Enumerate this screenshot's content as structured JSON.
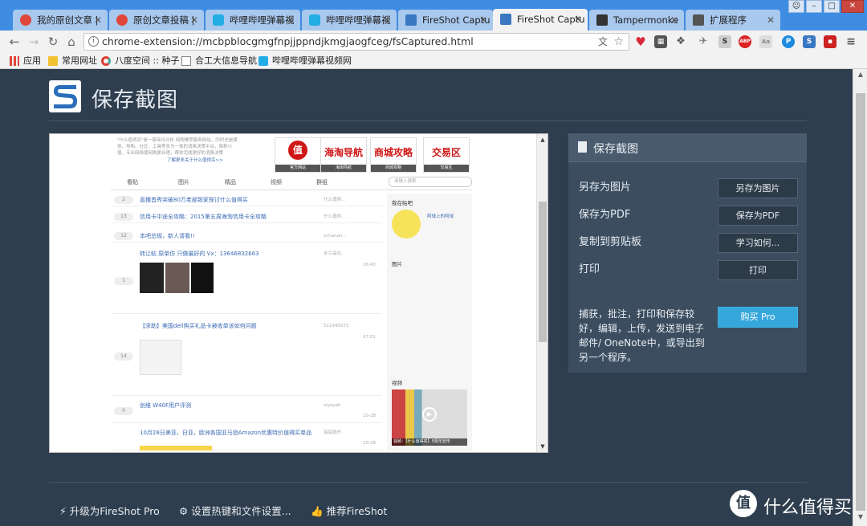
{
  "tabs": [
    {
      "label": "我的原创文章 | ",
      "color": "#e0463a"
    },
    {
      "label": "原创文章投稿 | ",
      "color": "#e0463a"
    },
    {
      "label": "哔哩哔哩弹幕视",
      "color": "#23ade5"
    },
    {
      "label": "哔哩哔哩弹幕视",
      "color": "#23ade5"
    },
    {
      "label": "FireShot Captu",
      "color": "#3a78c2"
    },
    {
      "label": "FireShot Captu",
      "color": "#3a78c2"
    },
    {
      "label": "Tampermonke",
      "color": "#333333"
    },
    {
      "label": "扩展程序",
      "color": "#555555"
    }
  ],
  "address": {
    "url": "chrome-extension://mcbpblocgmgfnpjjppndjkmgjaogfceg/fsCaptured.html"
  },
  "bookmarks": [
    "应用",
    "常用网址",
    "八度空间 :: 种子",
    "合工大信息导航",
    "哔哩哔哩弹幕视频网"
  ],
  "header": {
    "title": "保存截图"
  },
  "preview": {
    "intro": "\"什么值得买\"是一家商讯分析 网购推荐服务网站，同时也是媒体、导购、社区、工具等多为一体的消费决策平台，简称小值。专业网络使网购更合理，帮你完成更好的消费决策",
    "intro_link": "了解更多关于什么值得买>>",
    "promos": [
      {
        "big": "值",
        "cap": "官方网站"
      },
      {
        "big": "海淘导航",
        "cap": "海淘导航"
      },
      {
        "big": "商城攻略",
        "cap": "商城攻略"
      },
      {
        "big": "交易区",
        "cap": "交易区"
      }
    ],
    "nav_tabs": [
      "看贴",
      "图片",
      "精品",
      "视频",
      "群组"
    ],
    "search_placeholder": "请输入搜索",
    "rows": [
      {
        "num": "2",
        "title": "直播首秀突破80万老部致家探讨什么值得买",
        "meta": "什么值得..."
      },
      {
        "num": "13",
        "title": "信用卡中途全攻略：2015第五周海淘信用卡全攻略",
        "meta": "什么值得..."
      },
      {
        "num": "12",
        "title": "本吧总规，新人请看!!",
        "meta": "ychanan..."
      },
      {
        "num": "1",
        "title": "转让帖 原单仿 只做最好的 Vx：13646832663",
        "meta": "米兰品达...",
        "time": "16:43"
      },
      {
        "num": "14",
        "title": "【求助】美国dell购买礼品卡被收单该如何问题",
        "meta": "511940272",
        "time": "07:01"
      },
      {
        "num": "0",
        "title": "创维 W40F用户评测",
        "meta": "xiyeyah",
        "time": "10-28"
      },
      {
        "num": "",
        "title": "10月28日美亚，日亚，欧洲各国亚马逊Amazon优惠特价值得买单品",
        "meta": "海底航舟",
        "time": "10-28"
      }
    ],
    "side_heading": "我在贴吧",
    "side_user": "阿球上的阿球",
    "side_pics": "图片",
    "side_video": "视频",
    "video_caption": "视频：【什么值得买】5周年宣传"
  },
  "panel": {
    "heading": "保存截图",
    "actions": [
      {
        "label": "另存为图片",
        "button": "另存为图片"
      },
      {
        "label": "保存为PDF",
        "button": "保存为PDF"
      },
      {
        "label": "复制到剪贴板",
        "button": "学习如何..."
      },
      {
        "label": "打印",
        "button": "打印"
      }
    ],
    "description": "捕获，批注，打印和保存较好，编辑，上传，发送到电子邮件/ OneNote中，或导出到另一个程序。",
    "buy_label": "购买 Pro"
  },
  "footer": {
    "upgrade": "升级为FireShot Pro",
    "settings": "设置热键和文件设置...",
    "recommend": "推荐FireShot"
  },
  "watermark": {
    "text": "什么值得买"
  }
}
